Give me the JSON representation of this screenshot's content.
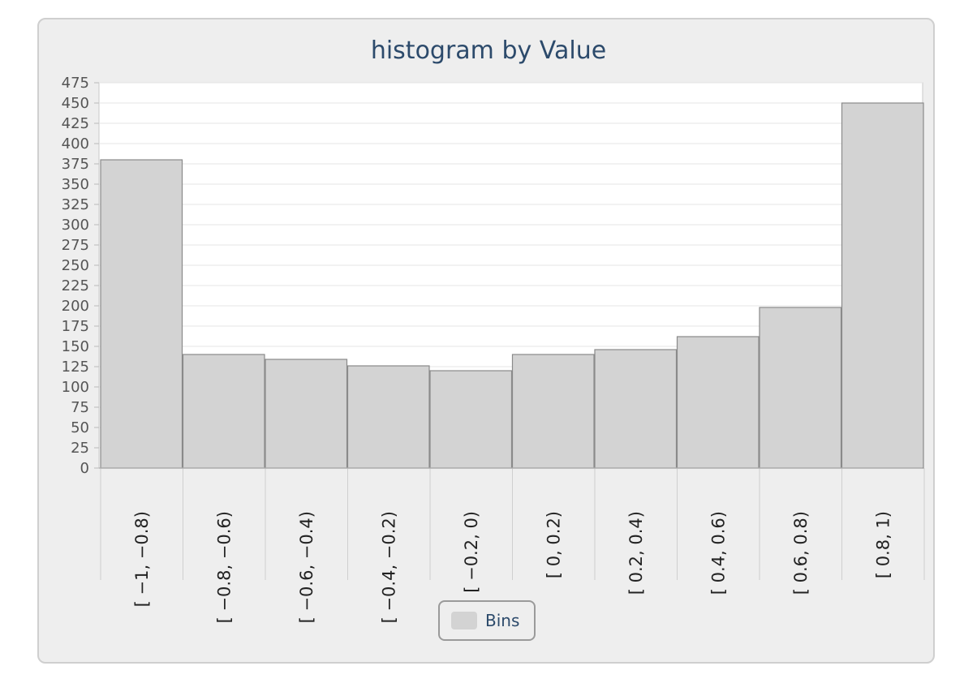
{
  "chart_data": {
    "type": "bar",
    "title": "histogram by Value",
    "xlabel": "",
    "ylabel": "",
    "categories": [
      "[ −1, −0.8)",
      "[ −0.8, −0.6)",
      "[ −0.6, −0.4)",
      "[ −0.4, −0.2)",
      "[ −0.2, 0)",
      "[ 0, 0.2)",
      "[ 0.2, 0.4)",
      "[ 0.4, 0.6)",
      "[ 0.6, 0.8)",
      "[ 0.8, 1)"
    ],
    "series": [
      {
        "name": "Bins",
        "values": [
          380,
          140,
          134,
          126,
          120,
          140,
          146,
          162,
          198,
          450
        ]
      }
    ],
    "ylim": [
      0,
      475
    ],
    "yticks": [
      0,
      25,
      50,
      75,
      100,
      125,
      150,
      175,
      200,
      225,
      250,
      275,
      300,
      325,
      350,
      375,
      400,
      425,
      450,
      475
    ],
    "grid": true,
    "legend_position": "bottom",
    "colors": {
      "bar_fill": "#d3d3d3",
      "bar_stroke": "#8a8a8a",
      "title": "#2c4a6b",
      "grid": "#e4e4e4"
    }
  }
}
